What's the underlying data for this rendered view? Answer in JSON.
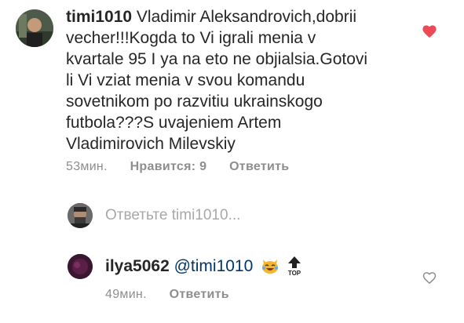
{
  "comment": {
    "username": "timi1010",
    "text": "Vladimir Aleksandrovich,dobrii vecher!!!Kogda to Vi igrali menia v kvartale 95 I ya na eto ne objialsia.Gotovi li Vi vziat menia v svou komandu sovetnikom po razvitiu ukrainskogo futbola???S uvajeniem Artem Vladimirovich Milevskiy",
    "lines": [
      "Vladimir Aleksandrovich,dobrii",
      "vecher!!!Kogda to Vi igrali menia v",
      "kvartale 95 I ya na eto ne objialsia.Gotovi",
      "li Vi vziat menia v svou komandu",
      "sovetnikom po razvitiu ukrainskogo",
      "futbola???S uvajeniem Artem",
      "Vladimirovich Milevskiy"
    ],
    "time": "53мин.",
    "likes": "Нравится: 9",
    "reply": "Ответить",
    "liked": true,
    "like_color": "#ed4956"
  },
  "reply_box": {
    "placeholder": "Ответьте timi1010..."
  },
  "reply": {
    "username": "ilya5062",
    "mention": "@timi1010",
    "emojis": [
      "crying-laughing-cat",
      "top-arrow"
    ],
    "time": "49мин.",
    "reply": "Ответить",
    "liked": false
  }
}
